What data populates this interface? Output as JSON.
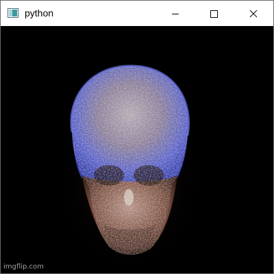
{
  "window": {
    "title": "python",
    "buttons": {
      "minimize": "minimize-icon",
      "maximize": "maximize-icon",
      "close": "close-icon"
    }
  },
  "viewport": {
    "subject": "volume-rendered skull",
    "colors": {
      "background": "#000000",
      "cranium_blue": "#5560c8",
      "face_bronze": "#c08a6a"
    }
  },
  "watermark": {
    "text": "imgflip.com"
  }
}
